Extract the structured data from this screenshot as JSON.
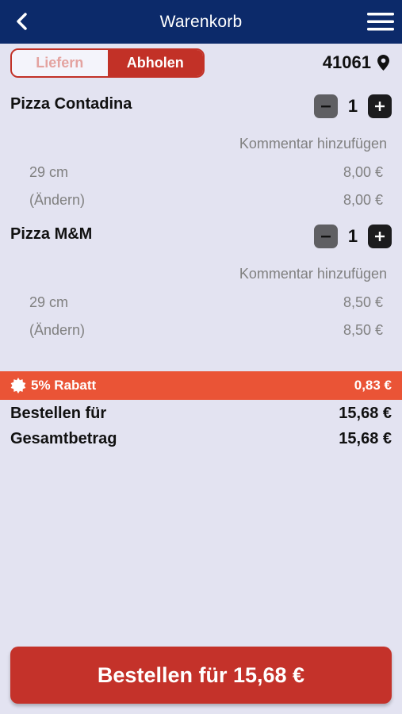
{
  "header": {
    "title": "Warenkorb",
    "back_icon": "chevron-left-icon",
    "menu_icon": "hamburger-menu-icon"
  },
  "mode": {
    "options": [
      "Liefern",
      "Abholen"
    ],
    "selected": "Abholen"
  },
  "location": {
    "postal_code": "41061",
    "icon": "map-pin-icon"
  },
  "cart": {
    "items": [
      {
        "name": "Pizza Contadina",
        "quantity": "1",
        "comment_link": "Kommentar hinzufügen",
        "size_label": "29 cm",
        "size_price": "8,00 €",
        "change_label": "(Ändern)",
        "change_price": "8,00 €"
      },
      {
        "name": "Pizza M&M",
        "quantity": "1",
        "comment_link": "Kommentar hinzufügen",
        "size_label": "29 cm",
        "size_price": "8,50 €",
        "change_label": "(Ändern)",
        "change_price": "8,50 €"
      }
    ]
  },
  "discount": {
    "label": "5% Rabatt",
    "value": "0,83 €",
    "icon": "badge-burst-icon"
  },
  "totals": {
    "order_for_label": "Bestellen für",
    "order_for_value": "15,68 €",
    "total_label": "Gesamtbetrag",
    "total_value": "15,68 €"
  },
  "order_button": {
    "label": "Bestellen für 15,68 €"
  },
  "colors": {
    "header_bg": "#0c2a6a",
    "accent_red": "#c4322a",
    "discount_orange": "#ea5436",
    "background": "#e3e3f1"
  }
}
